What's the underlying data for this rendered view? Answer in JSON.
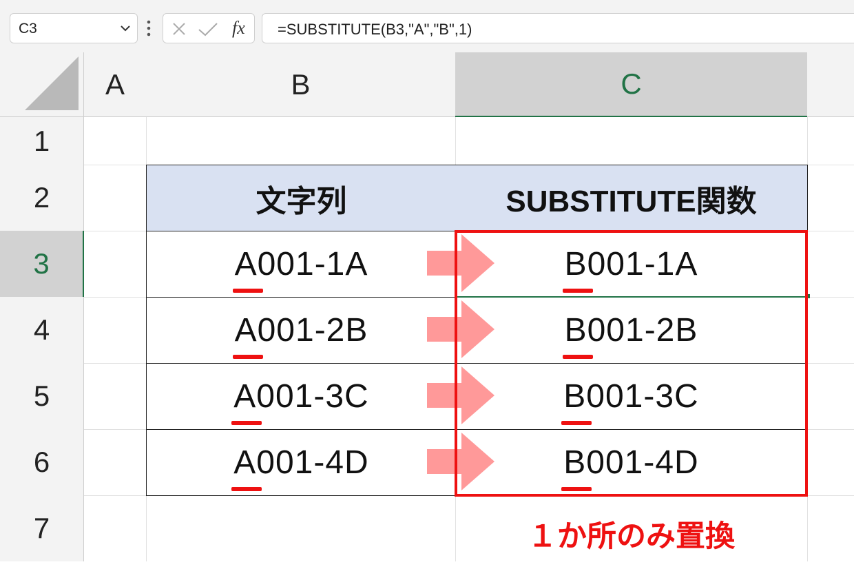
{
  "formula_bar": {
    "cell_reference": "C3",
    "formula": "=SUBSTITUTE(B3,\"A\",\"B\",1)",
    "fx_label": "fx"
  },
  "columns": [
    "A",
    "B",
    "C"
  ],
  "rows": [
    "1",
    "2",
    "3",
    "4",
    "5",
    "6",
    "7"
  ],
  "selected_cell": {
    "column": "C",
    "row": "3"
  },
  "table": {
    "headers": [
      "文字列",
      "SUBSTITUTE関数"
    ],
    "rows": [
      {
        "input_first": "A",
        "input_rest": "001-1A",
        "output_first": "B",
        "output_rest": "001-1A"
      },
      {
        "input_first": "A",
        "input_rest": "001-2B",
        "output_first": "B",
        "output_rest": "001-2B"
      },
      {
        "input_first": "A",
        "input_rest": "001-3C",
        "output_first": "B",
        "output_rest": "001-3C"
      },
      {
        "input_first": "A",
        "input_rest": "001-4D",
        "output_first": "B",
        "output_rest": "001-4D"
      }
    ]
  },
  "annotation": {
    "note": "１か所のみ置換",
    "highlight_color": "#ee1111",
    "arrow_color": "#ff9999",
    "header_fill": "#d9e1f2",
    "selection_color": "#217346"
  }
}
